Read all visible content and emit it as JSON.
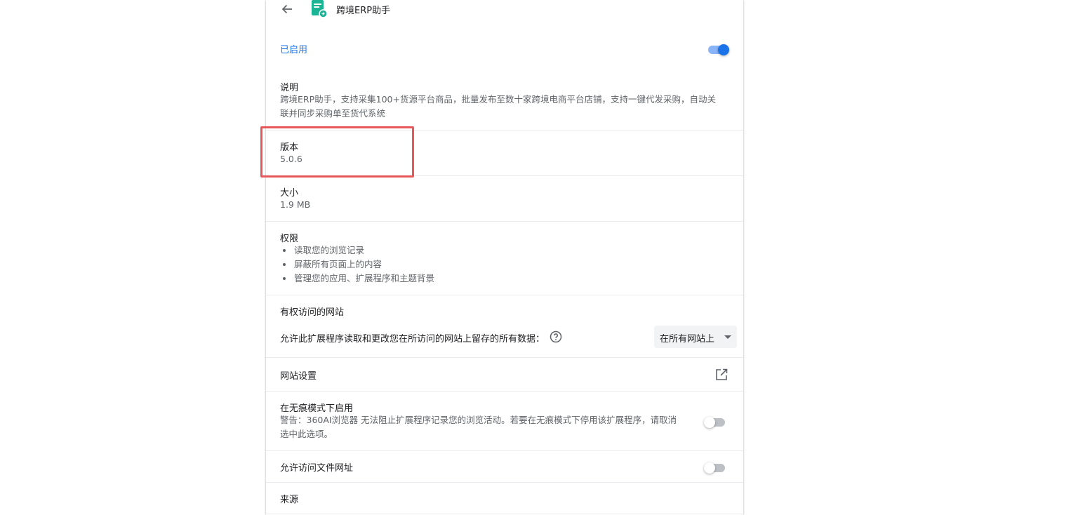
{
  "header": {
    "title": "跨境ERP助手",
    "back_icon": "arrow-back-icon",
    "extension_icon": "extension-logo-icon"
  },
  "enabled": {
    "label": "已启用",
    "toggle_on": true
  },
  "description": {
    "title": "说明",
    "line1": "跨境ERP助手，支持采集100+货源平台商品，批量发布至数十家跨境电商平台店铺，支持一键代发采购，自动关",
    "line2": "联并同步采购单至货代系统"
  },
  "version": {
    "title": "版本",
    "value": "5.0.6"
  },
  "size": {
    "title": "大小",
    "value": "1.9 MB"
  },
  "permissions": {
    "title": "权限",
    "items": [
      "读取您的浏览记录",
      "屏蔽所有页面上的内容",
      "管理您的应用、扩展程序和主题背景"
    ]
  },
  "site_access": {
    "title": "有权访问的网站",
    "desc": "允许此扩展程序读取和更改您在所访问的网站上留存的所有数据：",
    "selected": "在所有网站上",
    "help_icon": "help-circle-icon"
  },
  "site_settings": {
    "label": "网站设置",
    "icon": "open-in-new-icon"
  },
  "incognito": {
    "title": "在无痕模式下启用",
    "warning_line1": "警告：360AI浏览器 无法阻止扩展程序记录您的浏览活动。若要在无痕模式下停用该扩展程序，请取消",
    "warning_line2": "选中此选项。",
    "toggle_on": false
  },
  "file_urls": {
    "label": "允许访问文件网址",
    "toggle_on": false
  },
  "source": {
    "title": "来源"
  },
  "colors": {
    "accent": "#1a73e8",
    "highlight": "#e8585a",
    "brand_teal": "#1ab394"
  }
}
